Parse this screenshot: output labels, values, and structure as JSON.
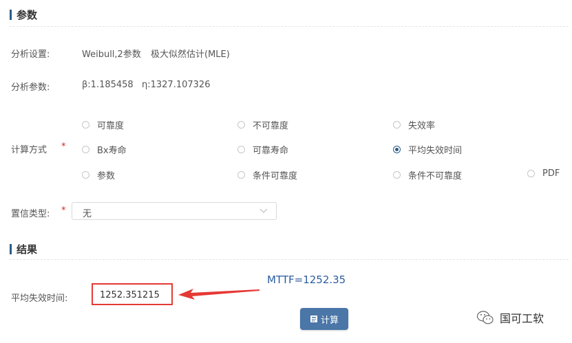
{
  "params_section": {
    "title": "参数"
  },
  "analysis_settings": {
    "label": "分析设置:",
    "distribution": "Weibull,2参数",
    "method": "极大似然估计(MLE)"
  },
  "analysis_params": {
    "label": "分析参数:",
    "beta": "β:1.185458",
    "eta": "η:1327.107326"
  },
  "calc_method": {
    "label": "计算方式",
    "required_mark": "*",
    "options": [
      "可靠度",
      "不可靠度",
      "失效率",
      "Bx寿命",
      "可靠寿命",
      "平均失效时间",
      "参数",
      "条件可靠度",
      "条件不可靠度",
      "PDF"
    ],
    "selected": "平均失效时间"
  },
  "confidence_type": {
    "label": "置信类型:",
    "required_mark": "*",
    "value": "无"
  },
  "results_section": {
    "title": "结果"
  },
  "result": {
    "label": "平均失效时间:",
    "value": "1252.351215"
  },
  "annotation": {
    "text": "MTTF=1252.35",
    "color": "#2a5b9f",
    "arrow_color": "#e53935"
  },
  "calc_button": {
    "label": "计算",
    "icon": "calculator-icon"
  },
  "watermark": {
    "text": "国可工软",
    "icon": "wechat-icon"
  },
  "colors": {
    "accent": "#2a5b86",
    "button": "#4a76a8",
    "highlight": "#e53935"
  }
}
